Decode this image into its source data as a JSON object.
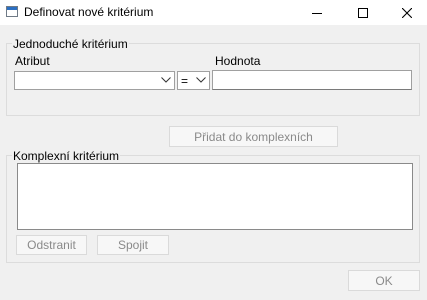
{
  "window": {
    "title": "Definovat nové kritérium",
    "icon": "app-window-icon",
    "controls": [
      "minimize-icon",
      "maximize-icon",
      "close-icon"
    ]
  },
  "simple_group": {
    "label": "Jednoduché kritérium",
    "attribute_label": "Atribut",
    "attribute_value": "",
    "operator_value": "=",
    "value_label": "Hodnota",
    "value_text": ""
  },
  "add_button": "Přidat do komplexních",
  "complex_group": {
    "label": "Komplexní kritérium",
    "items": [],
    "remove_button": "Odstranit",
    "join_button": "Spojit"
  },
  "ok_button": "OK"
}
